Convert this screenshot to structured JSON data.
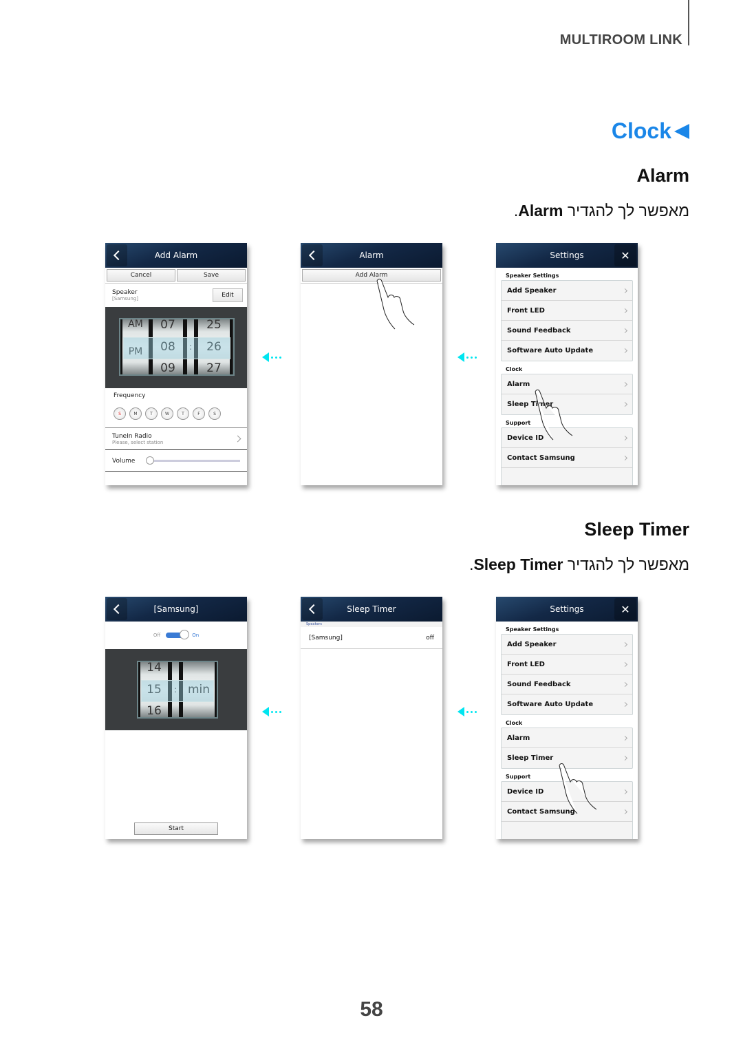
{
  "header": {
    "section": "MULTIROOM LINK"
  },
  "chapter": {
    "title": "Clock",
    "arrow_icon": "left-triangle"
  },
  "alarm_section": {
    "heading": "Alarm",
    "desc_prefix": "מאפשר לך להגדיר",
    "desc_term": "Alarm",
    "desc_suffix": "."
  },
  "sleep_section": {
    "heading": "Sleep Timer",
    "desc_prefix": "מאפשר לך להגדיר",
    "desc_term": "Sleep Timer",
    "desc_suffix": "."
  },
  "add_alarm_screen": {
    "title": "Add Alarm",
    "cancel": "Cancel",
    "save": "Save",
    "speaker_label": "Speaker",
    "speaker_value": "[Samsung]",
    "edit": "Edit",
    "time": {
      "ampm": [
        "AM",
        "PM",
        ""
      ],
      "hours": [
        "07",
        "08",
        "09"
      ],
      "separator": ":",
      "minutes": [
        "25",
        "26",
        "27"
      ]
    },
    "frequency_label": "Frequency",
    "days": [
      "S",
      "M",
      "T",
      "W",
      "T",
      "F",
      "S"
    ],
    "tunein_label": "TuneIn Radio",
    "tunein_sub": "Please, select station",
    "volume_label": "Volume",
    "volume_level": 0
  },
  "alarm_screen": {
    "title": "Alarm",
    "add_alarm": "Add Alarm"
  },
  "settings_screen": {
    "title": "Settings",
    "groups": [
      {
        "label": "Speaker Settings",
        "items": [
          "Add Speaker",
          "Front LED",
          "Sound Feedback",
          "Software Auto Update"
        ]
      },
      {
        "label": "Clock",
        "items": [
          "Alarm",
          "Sleep Timer"
        ]
      },
      {
        "label": "Support",
        "items": [
          "Device ID",
          "Contact Samsung"
        ]
      }
    ]
  },
  "sleep_config_screen": {
    "title": "[Samsung]",
    "off_label": "Off",
    "on_label": "On",
    "toggle_on": true,
    "timer": {
      "values": [
        "14",
        "15",
        "16"
      ],
      "separator": ":",
      "unit": "min"
    },
    "start": "Start"
  },
  "sleep_timer_screen": {
    "title": "Sleep Timer",
    "speakers_label": "Speakers",
    "speaker_name": "[Samsung]",
    "speaker_status": "off"
  },
  "page_number": "58",
  "colors": {
    "accent": "#1a86e8",
    "arrow": "#00e5f0",
    "header_dark": "#132846"
  }
}
